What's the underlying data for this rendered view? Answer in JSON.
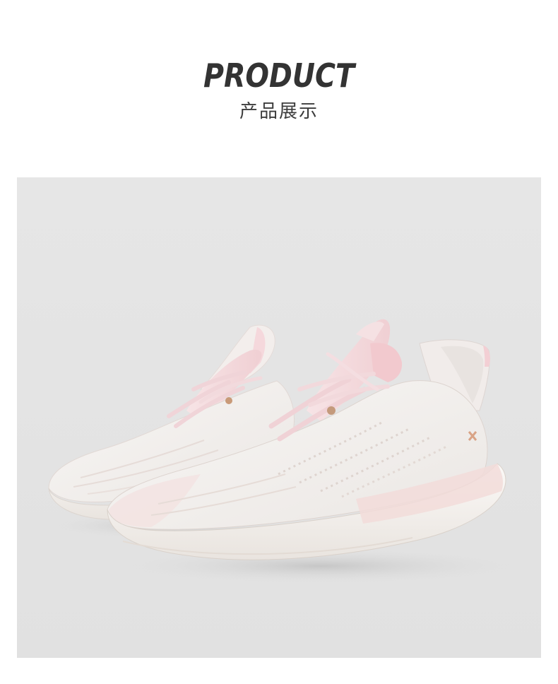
{
  "header": {
    "title": "PRODUCT",
    "subtitle": "产品展示"
  },
  "product_photo": {
    "subject": "pair-of-white-pink-knit-running-shoes",
    "colors": {
      "background": "#e3e3e3",
      "upper": "#f3f0ee",
      "sole": "#f7f4f1",
      "accent_pink": "#f3d3d6",
      "lace": "#f1d6da"
    }
  }
}
